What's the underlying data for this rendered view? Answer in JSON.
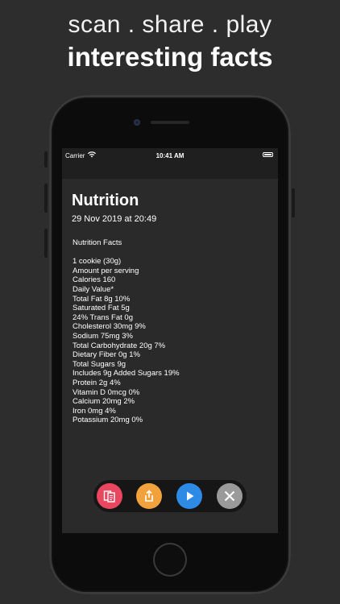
{
  "promo": {
    "tagline": "scan . share . play",
    "headline": "interesting facts"
  },
  "status_bar": {
    "carrier": "Carrier",
    "time": "10:41 AM"
  },
  "note": {
    "title": "Nutrition",
    "date": "29 Nov 2019 at 20:49",
    "lines": [
      "Nutrition Facts",
      "",
      "1 cookie (30g)",
      "Amount per serving",
      "Calories 160",
      "Daily Value*",
      "Total Fat 8g 10%",
      "Saturated Fat 5g",
      "24% Trans Fat 0g",
      "Cholesterol 30mg 9%",
      "Sodium 75mg 3%",
      "Total Carbohydrate 20g 7%",
      "Dietary Fiber 0g 1%",
      "Total Sugars 9g",
      "Includes 9g Added Sugars 19%",
      "Protein 2g 4%",
      "Vitamin D 0mcg 0%",
      "Calcium 20mg 2%",
      "Iron 0mg 4%",
      "Potassium 20mg 0%"
    ]
  },
  "toolbar": {
    "buttons": [
      {
        "icon": "cards-icon",
        "color": "#e8475f"
      },
      {
        "icon": "share-icon",
        "color": "#f2a23c"
      },
      {
        "icon": "play-icon",
        "color": "#2d8be6"
      },
      {
        "icon": "close-icon",
        "color": "#9a9a9a"
      }
    ]
  }
}
